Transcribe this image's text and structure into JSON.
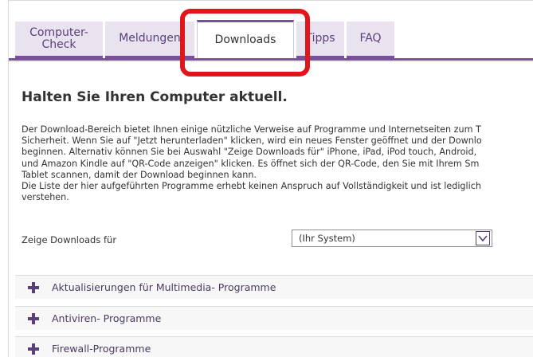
{
  "tabs": [
    {
      "label_line1": "Computer-",
      "label_line2": "Check"
    },
    {
      "label": "Meldungen"
    },
    {
      "label": "Downloads"
    },
    {
      "label": "Tipps"
    },
    {
      "label": "FAQ"
    }
  ],
  "main": {
    "heading": "Halten Sie Ihren Computer aktuell.",
    "paragraph_lines": [
      "Der Download-Bereich bietet Ihnen einige nützliche Verweise auf Programme und Internetseiten zum T",
      "Sicherheit. Wenn Sie auf \"Jetzt herunterladen\" klicken, wird ein neues Fenster geöffnet und der Downlo",
      "beginnen. Alternativ können Sie bei Auswahl \"Zeige Downloads für\" iPhone, iPad, iPod touch, Android,",
      "und Amazon Kindle auf \"QR-Code anzeigen\" klicken. Es öffnet sich der QR-Code, den Sie mit Ihrem Sm",
      "Tablet scannen, damit der Download beginnen kann.",
      "Die Liste der hier aufgeführten Programme erhebt keinen Anspruch auf Vollständigkeit und ist lediglich",
      "verstehen."
    ],
    "select_label": "Zeige Downloads für",
    "select_value": "(Ihr System)"
  },
  "accordion": [
    {
      "label": "Aktualisierungen für Multimedia- Programme"
    },
    {
      "label": "Antiviren- Programme"
    },
    {
      "label": "Firewall-Programme"
    }
  ],
  "colors": {
    "accent": "#7a4f9e",
    "tab_bg": "#e9e3f0",
    "highlight": "#e0161b"
  }
}
